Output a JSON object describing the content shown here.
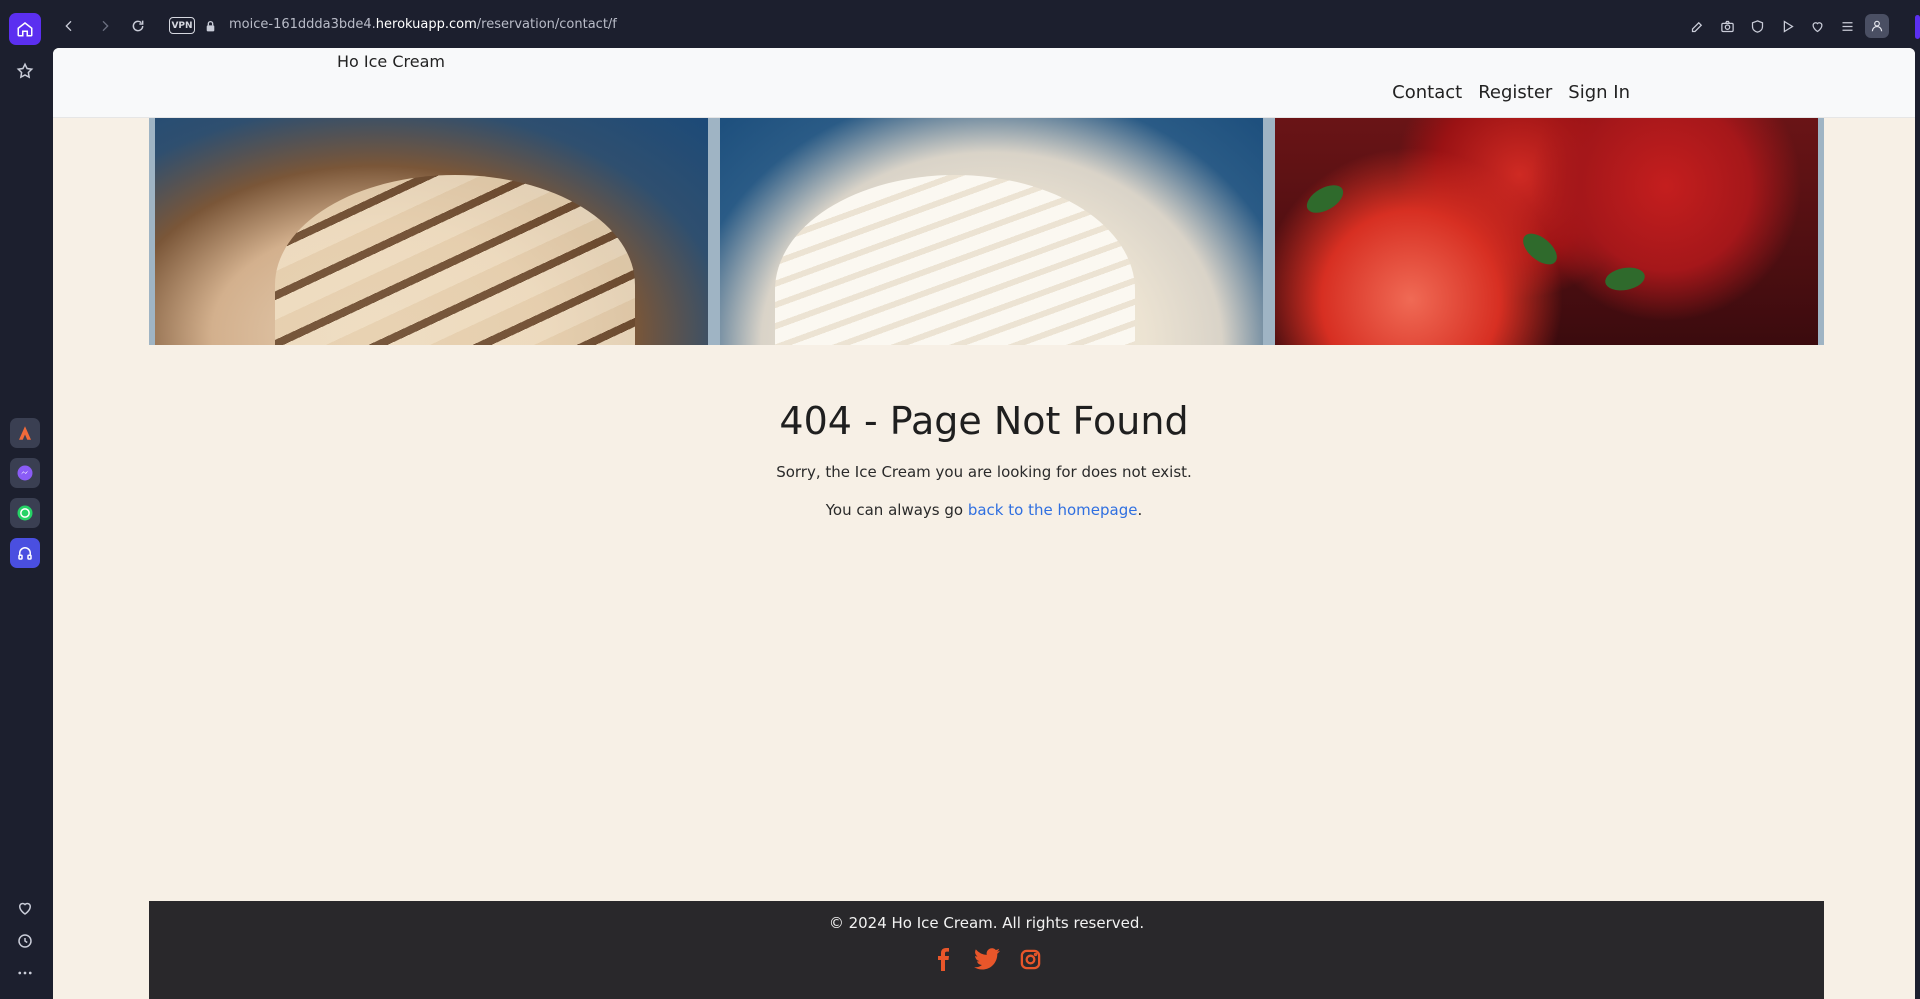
{
  "browser": {
    "url_prefix": "moice-161ddda3bde4.",
    "url_domain": "herokuapp.com",
    "url_path": "/reservation/contact/f",
    "vpn_label": "VPN"
  },
  "site": {
    "brand": "Ho Ice Cream",
    "nav": [
      "Contact",
      "Register",
      "Sign In"
    ]
  },
  "error": {
    "title": "404 - Page Not Found",
    "message": "Sorry, the Ice Cream you are looking for does not exist.",
    "hint_prefix": "You can always go ",
    "hint_link": "back to the homepage",
    "hint_suffix": "."
  },
  "footer": {
    "copyright": "© 2024 Ho Ice Cream. All rights reserved.",
    "social_icons": [
      "facebook-icon",
      "twitter-icon",
      "instagram-icon"
    ],
    "social_color": "#e8562a"
  },
  "colors": {
    "page_bg": "#f7f0e6",
    "header_bg": "#f8f9fa",
    "footer_bg": "#29282b",
    "link": "#2f6fe0",
    "browser_accent": "#5b2ff0"
  }
}
